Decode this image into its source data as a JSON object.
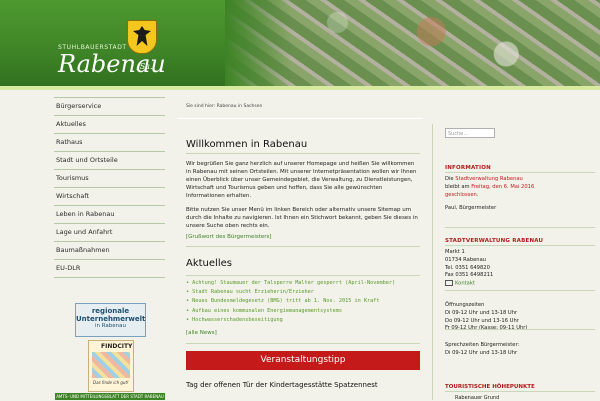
{
  "header": {
    "stadt_label": "STUHLBAUERSTADT",
    "city_name": "Rabenau",
    "city_suffix": "/Sa.",
    "colors": {
      "header_green": "#3e8326",
      "accent_red": "#c41a1a",
      "accent_green": "#3e8326"
    }
  },
  "breadcrumb": "Sie sind hier: Rabenau in Sachsen",
  "leftnav": {
    "items": [
      {
        "label": "Bürgerservice"
      },
      {
        "label": "Aktuelles"
      },
      {
        "label": "Rathaus"
      },
      {
        "label": "Stadt und Ortsteile"
      },
      {
        "label": "Tourismus"
      },
      {
        "label": "Wirtschaft"
      },
      {
        "label": "Leben in Rabenau"
      },
      {
        "label": "Lage und Anfahrt"
      },
      {
        "label": "Baumaßnahmen"
      },
      {
        "label": "EU-DLR"
      }
    ]
  },
  "banners": {
    "regional": {
      "line1": "regionale",
      "line2": "Unternehmerwelt",
      "line3": "in Rabenau"
    },
    "findcity": {
      "logo": "FINDCITY",
      "slogan": "Das finde ich gut!"
    },
    "amtsblatt": "AMTS- UND MITTEILUNGSBLATT DER STADT RABENAU"
  },
  "main": {
    "title": "Willkommen in Rabenau",
    "intro_p1": "Wir begrüßen Sie ganz herzlich auf unserer Homepage und heißen Sie willkommen in Rabenau mit seinen Ortsteilen. Mit unserer Internetpräsentation wollen wir Ihnen einen Überblick über unser Gemeindegebiet, die Verwaltung, zu Dienstleistungen, Wirtschaft und Tourismus geben und hoffen, dass Sie alle gewünschten Informationen erhalten.",
    "intro_p2": "Bitte nutzen Sie unser Menü im linken Bereich oder alternativ unsere Sitemap um durch die Inhalte zu navigieren. Ist Ihnen ein Stichwort bekannt, geben Sie dieses in unsere Suche oben rechts ein.",
    "greeting_link": "[Grußwort des Bürgermeisters]",
    "news_title": "Aktuelles",
    "news": [
      "Achtung! Staumauer der Talsperre Malter gesperrt (April-November)",
      "Stadt Rabenau sucht Erzieherin/Erzieher",
      "Neues Bundesmeldegesetz (BMG) tritt ab 1. Nov. 2015 in Kraft",
      "Aufbau eines kommunalen Energiemanagementsystems",
      "Hochwasserschadensbeseitigung"
    ],
    "all_news": "[alle News]",
    "event_bar": "Veranstaltungstipp",
    "event_title": "Tag der offenen Tür der Kindertagesstätte Spatzennest"
  },
  "sidebar": {
    "search_placeholder": "Suche…",
    "info": {
      "heading": "INFORMATION",
      "pre": "Die ",
      "link": "Stadtverwaltung Rabenau",
      "mid": " bleibt am ",
      "date": "Freitag, den 6. Mai 2016",
      "post": "geschlossen.",
      "sign": "Paul, Bürgermeister"
    },
    "stadtverwaltung": {
      "heading": "STADTVERWALTUNG RABENAU",
      "street": "Markt 1",
      "city": "01734 Rabenau",
      "tel": "Tel. 0351 649820",
      "fax": "Fax 0351 6498211",
      "kontakt": "Kontakt"
    },
    "hours": {
      "title": "Öffnungszeiten",
      "l1": "Di 09-12 Uhr und 13-18 Uhr",
      "l2": "Do 09-12 Uhr und 13-16 Uhr",
      "l3": "Fr 09-12 Uhr (Kasse: 09-11 Uhr)"
    },
    "sprech": {
      "title": "Sprechzeiten Bürgermeister:",
      "l1": "Di 09-12 Uhr und 13-18 Uhr"
    },
    "hp": {
      "heading": "TOURISTISCHE HÖHEPUNKTE",
      "text": "Rabenauer Grund"
    }
  }
}
